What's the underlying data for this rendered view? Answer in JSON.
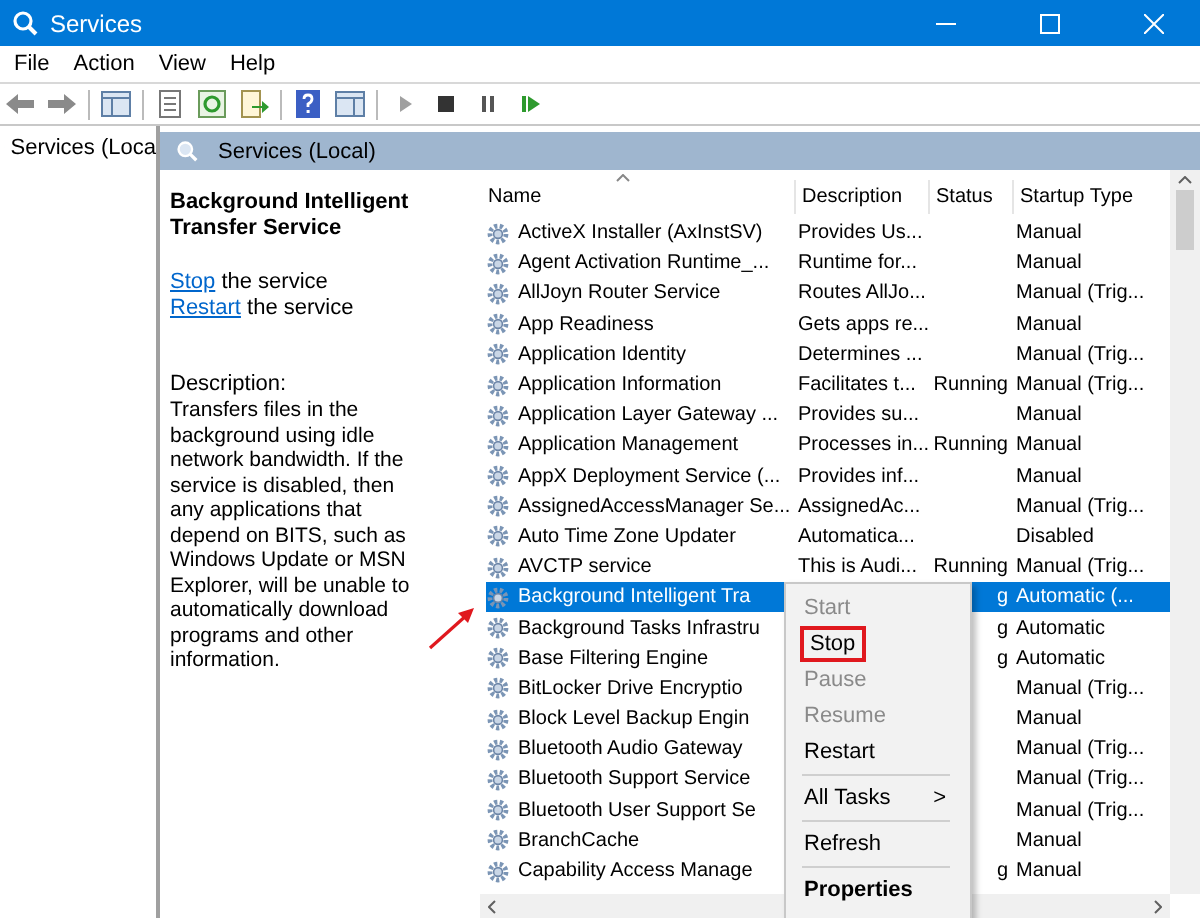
{
  "window": {
    "title": "Services"
  },
  "menu": [
    {
      "label": "File"
    },
    {
      "label": "Action"
    },
    {
      "label": "View"
    },
    {
      "label": "Help"
    }
  ],
  "tree": {
    "items": [
      {
        "label": "Services (Loca"
      }
    ]
  },
  "panel": {
    "title": "Services (Local)"
  },
  "details": {
    "title": "Background Intelligent Transfer Service",
    "actions": [
      {
        "link": "Stop",
        "text": "the service"
      },
      {
        "link": "Restart",
        "text": "the service"
      }
    ],
    "description_label": "Description:",
    "description": "Transfers files in the background using idle network bandwidth. If the service is disabled, then any applications that depend on BITS, such as Windows Update or MSN Explorer, will be unable to automatically download programs and other information."
  },
  "table": {
    "columns": [
      {
        "label": "Name",
        "sorted": true
      },
      {
        "label": "Description",
        "sorted": false
      },
      {
        "label": "Status",
        "sorted": false
      },
      {
        "label": "Startup Type",
        "sorted": false
      }
    ],
    "rows": [
      {
        "name": "ActiveX Installer (AxInstSV)",
        "description": "Provides Us...",
        "startup": "Manual",
        "selected": false
      },
      {
        "name": "Agent Activation Runtime_...",
        "description": "Runtime for...",
        "startup": "Manual",
        "selected": false
      },
      {
        "name": "AllJoyn Router Service",
        "description": "Routes AllJo...",
        "startup": "Manual (Trig...",
        "selected": false
      },
      {
        "name": "App Readiness",
        "description": "Gets apps re...",
        "startup": "Manual",
        "selected": false
      },
      {
        "name": "Application Identity",
        "description": "Determines ...",
        "startup": "Manual (Trig...",
        "selected": false
      },
      {
        "name": "Application Information",
        "description": "Facilitates t...",
        "status": "Running",
        "startup": "Manual (Trig...",
        "selected": false
      },
      {
        "name": "Application Layer Gateway ...",
        "description": "Provides su...",
        "startup": "Manual",
        "selected": false
      },
      {
        "name": "Application Management",
        "description": "Processes in...",
        "status": "Running",
        "startup": "Manual",
        "selected": false
      },
      {
        "name": "AppX Deployment Service (...",
        "description": "Provides inf...",
        "startup": "Manual",
        "selected": false
      },
      {
        "name": "AssignedAccessManager Se...",
        "description": "AssignedAc...",
        "startup": "Manual (Trig...",
        "selected": false
      },
      {
        "name": "Auto Time Zone Updater",
        "description": "Automatica...",
        "startup": "Disabled",
        "selected": false
      },
      {
        "name": "AVCTP service",
        "description": "This is Audi...",
        "status": "Running",
        "startup": "Manual (Trig...",
        "selected": false
      },
      {
        "name": "Background Intelligent Tra",
        "status": "g",
        "startup": "Automatic (...",
        "selected": true
      },
      {
        "name": "Background Tasks Infrastru",
        "status": "g",
        "startup": "Automatic",
        "selected": false
      },
      {
        "name": "Base Filtering Engine",
        "status": "g",
        "startup": "Automatic",
        "selected": false
      },
      {
        "name": "BitLocker Drive Encryptio",
        "startup": "Manual (Trig...",
        "selected": false
      },
      {
        "name": "Block Level Backup Engin",
        "startup": "Manual",
        "selected": false
      },
      {
        "name": "Bluetooth Audio Gateway",
        "startup": "Manual (Trig...",
        "selected": false
      },
      {
        "name": "Bluetooth Support Service",
        "startup": "Manual (Trig...",
        "selected": false
      },
      {
        "name": "Bluetooth User Support Se",
        "startup": "Manual (Trig...",
        "selected": false
      },
      {
        "name": "BranchCache",
        "startup": "Manual",
        "selected": false
      },
      {
        "name": "Capability Access Manage",
        "status": "g",
        "startup": "Manual",
        "selected": false
      }
    ]
  },
  "context_menu": {
    "items": [
      {
        "kind": "item",
        "label": "Start",
        "disabled": true,
        "highlighted": false,
        "default": false
      },
      {
        "kind": "item",
        "label": "Stop",
        "disabled": false,
        "highlighted": true,
        "default": false
      },
      {
        "kind": "item",
        "label": "Pause",
        "disabled": true,
        "highlighted": false,
        "default": false
      },
      {
        "kind": "item",
        "label": "Resume",
        "disabled": true,
        "highlighted": false,
        "default": false
      },
      {
        "kind": "item",
        "label": "Restart",
        "disabled": false,
        "highlighted": false,
        "default": false
      },
      {
        "kind": "separator"
      },
      {
        "kind": "item",
        "label": "All Tasks",
        "submenu": ">",
        "disabled": false,
        "highlighted": false,
        "default": false
      },
      {
        "kind": "separator"
      },
      {
        "kind": "item",
        "label": "Refresh",
        "disabled": false,
        "highlighted": false,
        "default": false
      },
      {
        "kind": "separator"
      },
      {
        "kind": "item",
        "label": "Properties",
        "disabled": false,
        "highlighted": false,
        "default": true
      }
    ]
  }
}
